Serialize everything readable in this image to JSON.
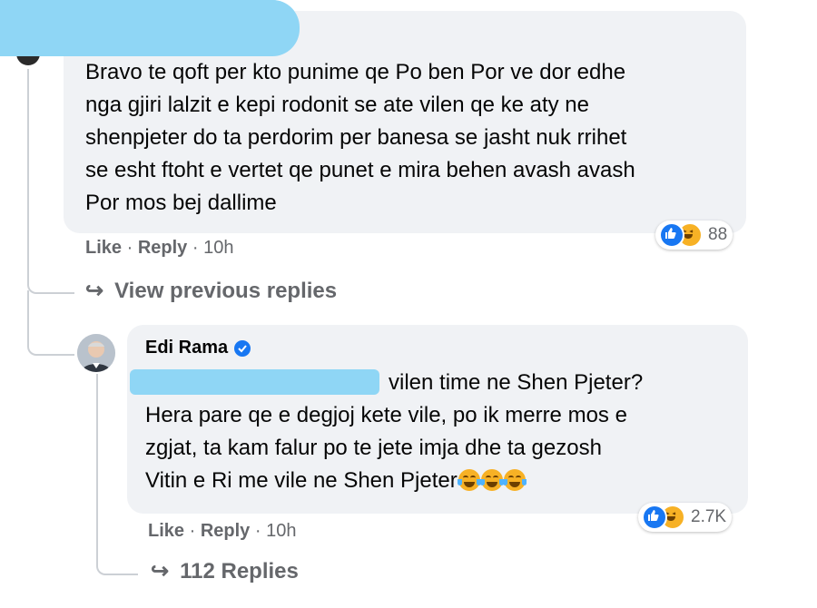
{
  "comment1": {
    "lines": [
      "Bravo te qoft per kto punime qe Po ben Por ve dor edhe",
      "nga gjiri lalzit e kepi rodonit se ate vilen qe ke aty ne",
      "shenpjeter do ta perdorim per banesa se jasht nuk rrihet",
      "se esht ftoht e vertet qe punet e mira behen avash avash",
      "Por mos bej dallime"
    ],
    "like_label": "Like",
    "reply_label": "Reply",
    "separator": "·",
    "time": "10h",
    "reaction_count": "88"
  },
  "view_previous": {
    "label": "View previous replies"
  },
  "reply1": {
    "author": "Edi Rama",
    "lines": [
      " vilen time ne Shen Pjeter?",
      "Hera pare qe e degjoj kete vile, po ik merre mos e",
      "zgjat, ta kam falur po te jete imja dhe ta gezosh",
      "Vitin e Ri me vile ne Shen Pjeter"
    ],
    "like_label": "Like",
    "reply_label": "Reply",
    "separator": "·",
    "time": "10h",
    "reaction_count": "2.7K"
  },
  "more_replies": {
    "label": "112 Replies"
  },
  "colors": {
    "bubble": "#f0f2f5",
    "meta_text": "#65676b",
    "redaction": "#8fd6f5",
    "like_blue": "#1877f2",
    "verified_blue": "#1877f2",
    "haha_yellow": "#f7b125"
  },
  "icons": [
    "like-icon",
    "haha-icon",
    "reply-arrow-icon",
    "verified-badge-icon",
    "laughing-emoji-icon"
  ]
}
